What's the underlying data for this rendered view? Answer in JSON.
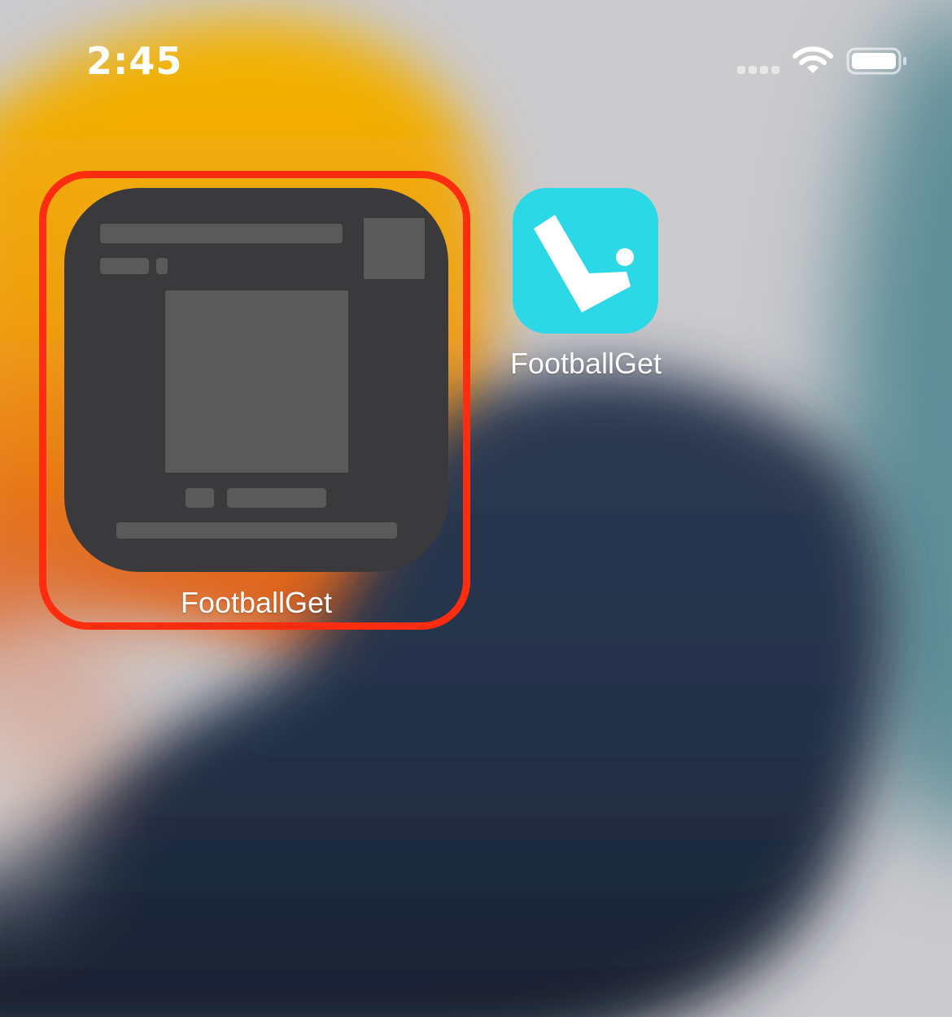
{
  "status_bar": {
    "time": "2:45",
    "icons": [
      "cellular-signal-icon",
      "wifi-icon",
      "battery-icon"
    ]
  },
  "home_screen": {
    "widget": {
      "label": "FootballGet",
      "state": "placeholder",
      "highlighted": true,
      "highlight_color": "#ff2d10",
      "background_color": "#3a3a3c"
    },
    "apps": [
      {
        "label": "FootballGet",
        "icon": "footballget-app-icon",
        "icon_color": "#2cd7e6"
      }
    ]
  }
}
